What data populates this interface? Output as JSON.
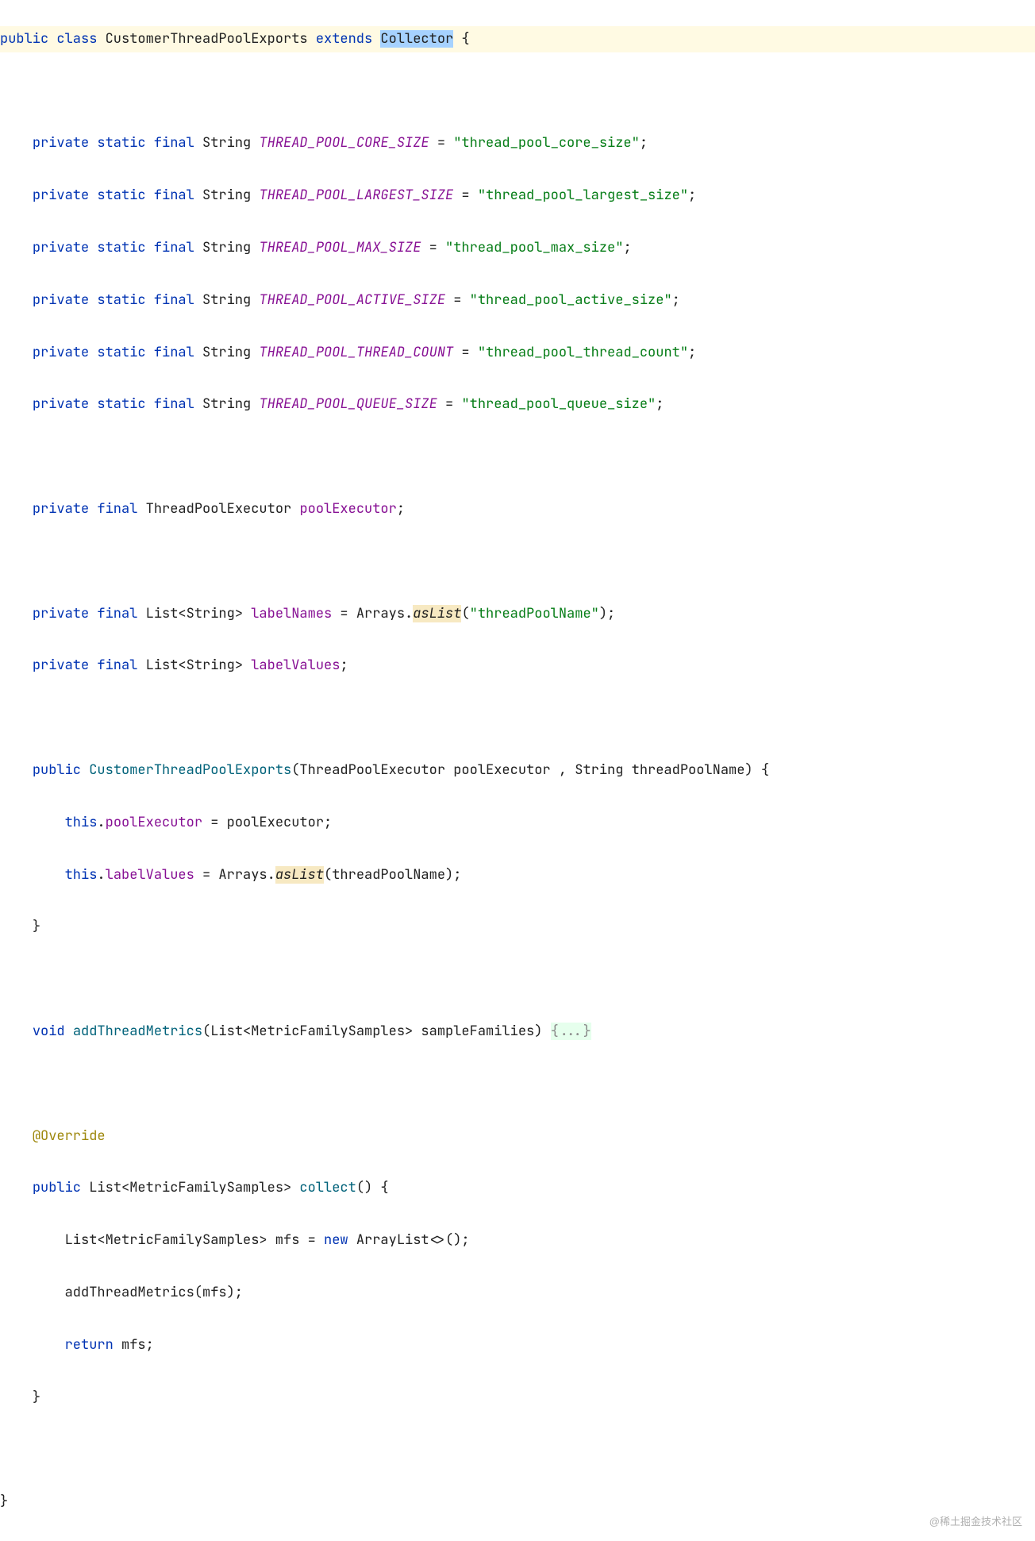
{
  "watermark": "@稀土掘金技术社区",
  "code": {
    "line1": {
      "public": "public",
      "class": "class",
      "className": "CustomerThreadPoolExports",
      "extends": "extends",
      "superClass": "Collector",
      "brace": " {"
    },
    "constants": [
      {
        "mods": "private static final",
        "type": "String",
        "name": "THREAD_POOL_CORE_SIZE",
        "value": "\"thread_pool_core_size\""
      },
      {
        "mods": "private static final",
        "type": "String",
        "name": "THREAD_POOL_LARGEST_SIZE",
        "value": "\"thread_pool_largest_size\""
      },
      {
        "mods": "private static final",
        "type": "String",
        "name": "THREAD_POOL_MAX_SIZE",
        "value": "\"thread_pool_max_size\""
      },
      {
        "mods": "private static final",
        "type": "String",
        "name": "THREAD_POOL_ACTIVE_SIZE",
        "value": "\"thread_pool_active_size\""
      },
      {
        "mods": "private static final",
        "type": "String",
        "name": "THREAD_POOL_THREAD_COUNT",
        "value": "\"thread_pool_thread_count\""
      },
      {
        "mods": "private static final",
        "type": "String",
        "name": "THREAD_POOL_QUEUE_SIZE",
        "value": "\"thread_pool_queue_size\""
      }
    ],
    "field1": {
      "mods": "private final",
      "type": "ThreadPoolExecutor",
      "name": "poolExecutor"
    },
    "field2": {
      "mods": "private final",
      "type": "List<String>",
      "name": "labelNames",
      "eq": " = ",
      "expr1": "Arrays.",
      "asList": "asList",
      "expr2": "(",
      "arg": "\"threadPoolName\"",
      "expr3": ");"
    },
    "field3": {
      "mods": "private final",
      "type": "List<String>",
      "name": "labelValues"
    },
    "ctor": {
      "mods": "public",
      "name": "CustomerThreadPoolExports",
      "params": "(ThreadPoolExecutor poolExecutor , String threadPoolName) {",
      "body1": {
        "thisKw": "this",
        "dot": ".",
        "field": "poolExecutor",
        "rest": " = poolExecutor;"
      },
      "body2": {
        "thisKw": "this",
        "dot": ".",
        "field": "labelValues",
        "rest1": " = Arrays.",
        "asList": "asList",
        "rest2": "(threadPoolName);"
      },
      "close": "}"
    },
    "method1": {
      "ret": "void",
      "name": "addThreadMetrics",
      "params": "(List<MetricFamilySamples> sampleFamilies) ",
      "fold": "{...}"
    },
    "annotation": "@Override",
    "collect": {
      "mods": "public",
      "retType": "List<MetricFamilySamples>",
      "name": "collect",
      "params": "() {",
      "body1a": "List<MetricFamilySamples> mfs = ",
      "body1new": "new",
      "body1b": " ArrayList<>();",
      "body2": "addThreadMetrics(mfs);",
      "body3ret": "return",
      "body3rest": " mfs;",
      "close": "}"
    },
    "classClose": "}"
  }
}
